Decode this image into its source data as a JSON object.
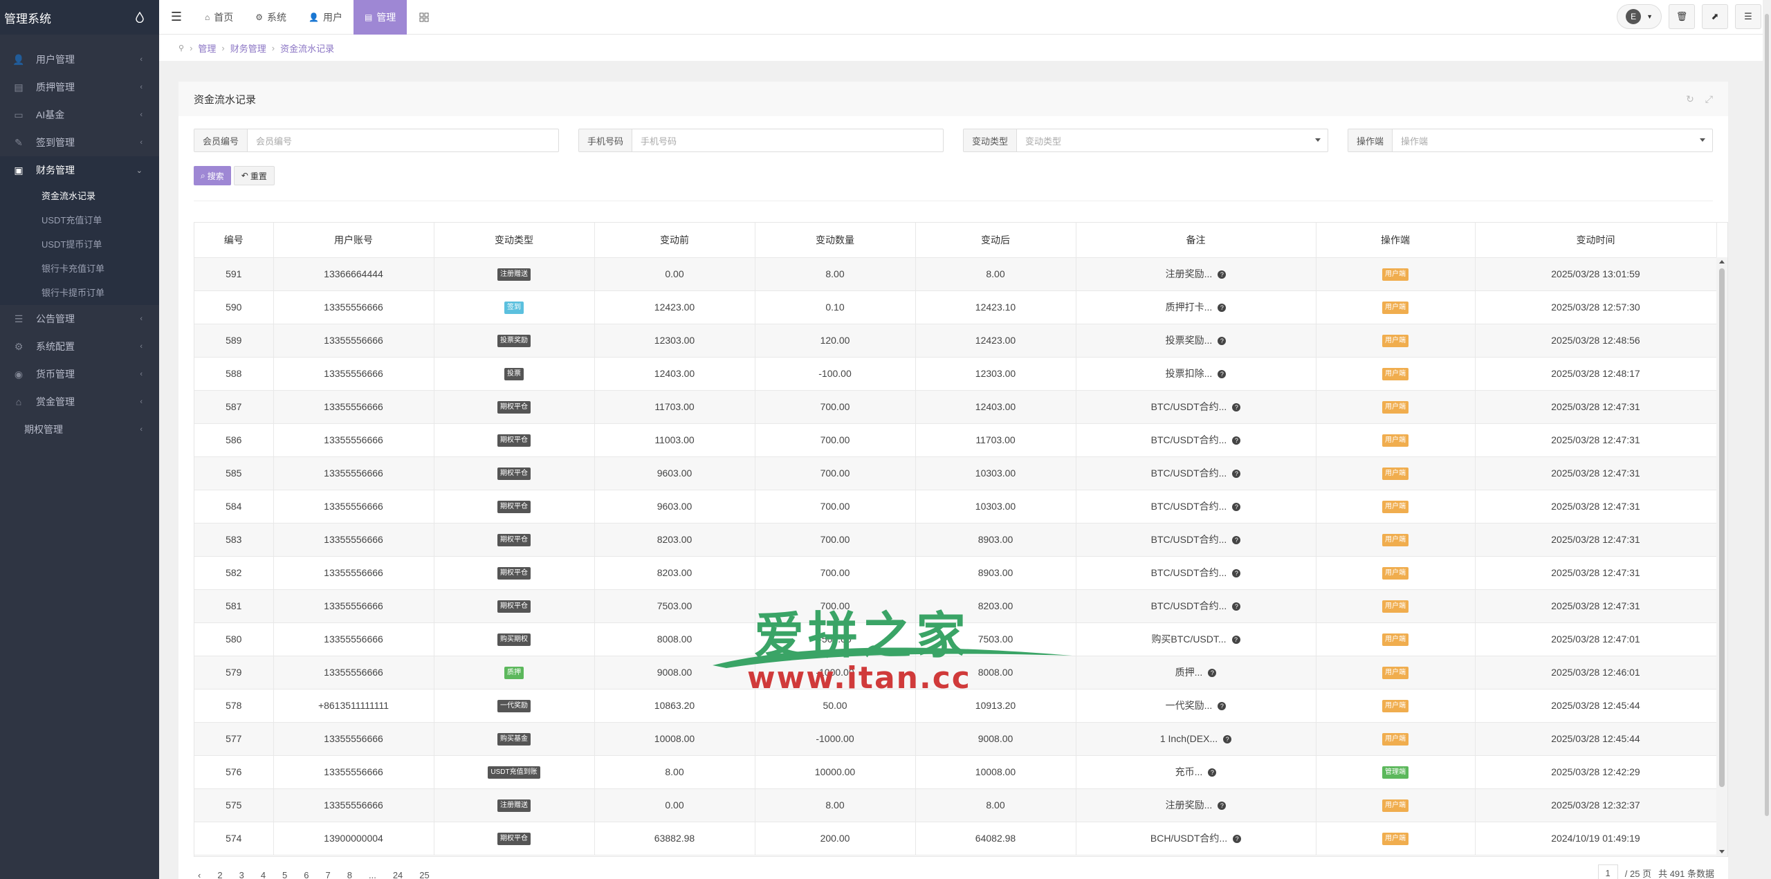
{
  "brand": {
    "title": "管理系统"
  },
  "sidebar": {
    "items": [
      {
        "label": "用户管理",
        "icon": "user-icon"
      },
      {
        "label": "质押管理",
        "icon": "list-icon"
      },
      {
        "label": "AI基金",
        "icon": "monitor-icon"
      },
      {
        "label": "签到管理",
        "icon": "edit-icon"
      },
      {
        "label": "财务管理",
        "icon": "money-icon",
        "active": true,
        "children": [
          "资金流水记录",
          "USDT充值订单",
          "USDT提币订单",
          "银行卡充值订单",
          "银行卡提币订单"
        ]
      },
      {
        "label": "公告管理",
        "icon": "bars-icon"
      },
      {
        "label": "系统配置",
        "icon": "cogs-icon"
      },
      {
        "label": "货币管理",
        "icon": "coin-icon"
      },
      {
        "label": "赏金管理",
        "icon": "bank-icon"
      },
      {
        "label": "期权管理",
        "icon": ""
      }
    ]
  },
  "topbar": {
    "tabs": [
      {
        "label": "首页",
        "icon": "home-icon"
      },
      {
        "label": "系统",
        "icon": "gear-icon"
      },
      {
        "label": "用户",
        "icon": "user-icon"
      },
      {
        "label": "管理",
        "icon": "briefcase-icon",
        "active": true
      }
    ],
    "avatar_letter": "E"
  },
  "breadcrumb": [
    "管理",
    "财务管理",
    "资金流水记录"
  ],
  "panel": {
    "title": "资金流水记录"
  },
  "filters": [
    {
      "label": "会员编号",
      "placeholder": "会员编号",
      "type": "input"
    },
    {
      "label": "手机号码",
      "placeholder": "手机号码",
      "type": "input"
    },
    {
      "label": "变动类型",
      "placeholder": "变动类型",
      "type": "select"
    },
    {
      "label": "操作端",
      "placeholder": "操作端",
      "type": "select"
    }
  ],
  "actions": {
    "search": "搜索",
    "reset": "重置"
  },
  "table": {
    "headers": [
      "编号",
      "用户账号",
      "变动类型",
      "变动前",
      "变动数量",
      "变动后",
      "备注",
      "操作端",
      "变动时间"
    ],
    "rows": [
      [
        "591",
        "13366664444",
        {
          "t": "注册赠送",
          "c": "#555"
        },
        "0.00",
        "8.00",
        "8.00",
        "注册奖励...",
        {
          "t": "用户端",
          "c": "#f0ad4e"
        },
        "2025/03/28 13:01:59"
      ],
      [
        "590",
        "13355556666",
        {
          "t": "签到",
          "c": "#5bc0de"
        },
        "12423.00",
        "0.10",
        "12423.10",
        "质押打卡...",
        {
          "t": "用户端",
          "c": "#f0ad4e"
        },
        "2025/03/28 12:57:30"
      ],
      [
        "589",
        "13355556666",
        {
          "t": "投票奖励",
          "c": "#555"
        },
        "12303.00",
        "120.00",
        "12423.00",
        "投票奖励...",
        {
          "t": "用户端",
          "c": "#f0ad4e"
        },
        "2025/03/28 12:48:56"
      ],
      [
        "588",
        "13355556666",
        {
          "t": "投票",
          "c": "#555"
        },
        "12403.00",
        "-100.00",
        "12303.00",
        "投票扣除...",
        {
          "t": "用户端",
          "c": "#f0ad4e"
        },
        "2025/03/28 12:48:17"
      ],
      [
        "587",
        "13355556666",
        {
          "t": "期权平仓",
          "c": "#555"
        },
        "11703.00",
        "700.00",
        "12403.00",
        "BTC/USDT合约...",
        {
          "t": "用户端",
          "c": "#f0ad4e"
        },
        "2025/03/28 12:47:31"
      ],
      [
        "586",
        "13355556666",
        {
          "t": "期权平仓",
          "c": "#555"
        },
        "11003.00",
        "700.00",
        "11703.00",
        "BTC/USDT合约...",
        {
          "t": "用户端",
          "c": "#f0ad4e"
        },
        "2025/03/28 12:47:31"
      ],
      [
        "585",
        "13355556666",
        {
          "t": "期权平仓",
          "c": "#555"
        },
        "9603.00",
        "700.00",
        "10303.00",
        "BTC/USDT合约...",
        {
          "t": "用户端",
          "c": "#f0ad4e"
        },
        "2025/03/28 12:47:31"
      ],
      [
        "584",
        "13355556666",
        {
          "t": "期权平仓",
          "c": "#555"
        },
        "9603.00",
        "700.00",
        "10303.00",
        "BTC/USDT合约...",
        {
          "t": "用户端",
          "c": "#f0ad4e"
        },
        "2025/03/28 12:47:31"
      ],
      [
        "583",
        "13355556666",
        {
          "t": "期权平仓",
          "c": "#555"
        },
        "8203.00",
        "700.00",
        "8903.00",
        "BTC/USDT合约...",
        {
          "t": "用户端",
          "c": "#f0ad4e"
        },
        "2025/03/28 12:47:31"
      ],
      [
        "582",
        "13355556666",
        {
          "t": "期权平仓",
          "c": "#555"
        },
        "8203.00",
        "700.00",
        "8903.00",
        "BTC/USDT合约...",
        {
          "t": "用户端",
          "c": "#f0ad4e"
        },
        "2025/03/28 12:47:31"
      ],
      [
        "581",
        "13355556666",
        {
          "t": "期权平仓",
          "c": "#555"
        },
        "7503.00",
        "700.00",
        "8203.00",
        "BTC/USDT合约...",
        {
          "t": "用户端",
          "c": "#f0ad4e"
        },
        "2025/03/28 12:47:31"
      ],
      [
        "580",
        "13355556666",
        {
          "t": "购买期权",
          "c": "#555"
        },
        "8008.00",
        "-505.00",
        "7503.00",
        "购买BTC/USDT...",
        {
          "t": "用户端",
          "c": "#f0ad4e"
        },
        "2025/03/28 12:47:01"
      ],
      [
        "579",
        "13355556666",
        {
          "t": "质押",
          "c": "#5cb85c"
        },
        "9008.00",
        "-1000.00",
        "8008.00",
        "质押...",
        {
          "t": "用户端",
          "c": "#f0ad4e"
        },
        "2025/03/28 12:46:01"
      ],
      [
        "578",
        "+8613511111111",
        {
          "t": "一代奖励",
          "c": "#555"
        },
        "10863.20",
        "50.00",
        "10913.20",
        "一代奖励...",
        {
          "t": "用户端",
          "c": "#f0ad4e"
        },
        "2025/03/28 12:45:44"
      ],
      [
        "577",
        "13355556666",
        {
          "t": "购买基金",
          "c": "#555"
        },
        "10008.00",
        "-1000.00",
        "9008.00",
        "1 Inch(DEX...",
        {
          "t": "用户端",
          "c": "#f0ad4e"
        },
        "2025/03/28 12:45:44"
      ],
      [
        "576",
        "13355556666",
        {
          "t": "USDT充值到账",
          "c": "#555"
        },
        "8.00",
        "10000.00",
        "10008.00",
        "充币...",
        {
          "t": "管理端",
          "c": "#5cb85c"
        },
        "2025/03/28 12:42:29"
      ],
      [
        "575",
        "13355556666",
        {
          "t": "注册赠送",
          "c": "#555"
        },
        "0.00",
        "8.00",
        "8.00",
        "注册奖励...",
        {
          "t": "用户端",
          "c": "#f0ad4e"
        },
        "2025/03/28 12:32:37"
      ],
      [
        "574",
        "13900000004",
        {
          "t": "期权平仓",
          "c": "#555"
        },
        "63882.98",
        "200.00",
        "64082.98",
        "BCH/USDT合约...",
        {
          "t": "用户端",
          "c": "#f0ad4e"
        },
        "2024/10/19 01:49:19"
      ]
    ]
  },
  "pager": {
    "pages": [
      "2",
      "3",
      "4",
      "5",
      "6",
      "7",
      "8",
      "...",
      "24",
      "25"
    ],
    "total_pages": "/ 25 页",
    "total_records": "共 491 条数据"
  },
  "watermark": {
    "line1": "爱拼之家",
    "line2": "www.itan.cc"
  }
}
